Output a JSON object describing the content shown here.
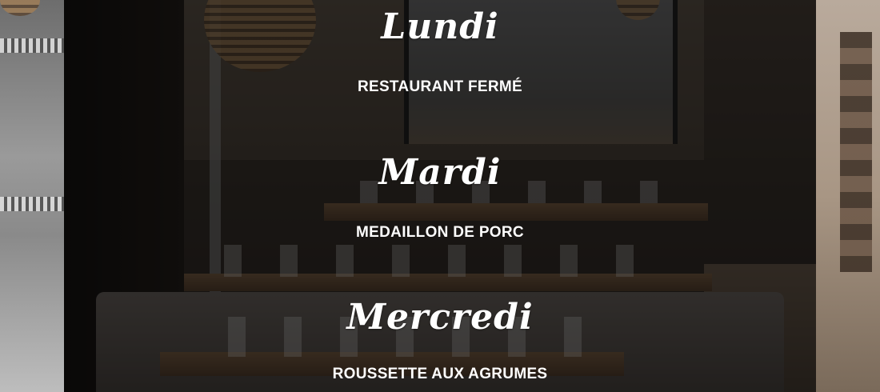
{
  "menu": {
    "days": [
      {
        "name": "Lundi",
        "dish": "RESTAURANT FERMÉ"
      },
      {
        "name": "Mardi",
        "dish": "MEDAILLON DE PORC"
      },
      {
        "name": "Mercredi",
        "dish": "ROUSSETTE AUX AGRUMES"
      }
    ]
  },
  "colors": {
    "text": "#ffffff",
    "overlay": "#000000"
  }
}
